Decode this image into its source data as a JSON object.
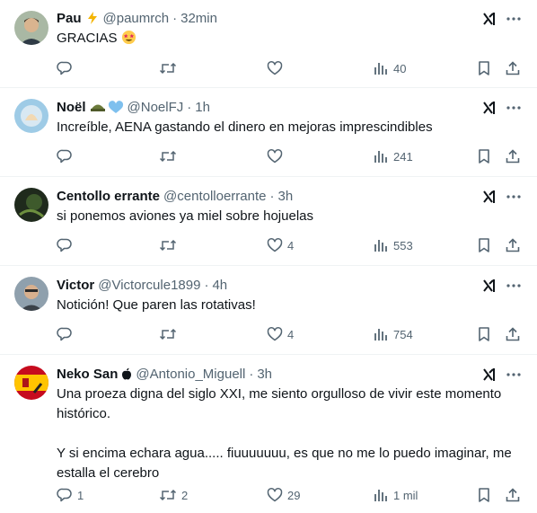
{
  "colors": {
    "muted": "#536471",
    "text": "#0f1419",
    "divider": "#eff3f4"
  },
  "tweets": [
    {
      "name": "Pau",
      "name_emoji": "lightning-emoji",
      "handle": "@paumrch",
      "time": "32min",
      "text": "GRACIAS",
      "text_emoji": "star-struck-emoji",
      "replies": "",
      "retweets": "",
      "likes": "",
      "views": "40"
    },
    {
      "name": "Noël",
      "name_emoji": "helmet-and-heart-emoji",
      "handle": "@NoelFJ",
      "time": "1h",
      "text": "Increíble, AENA gastando el dinero en mejoras imprescindibles",
      "replies": "",
      "retweets": "",
      "likes": "",
      "views": "241"
    },
    {
      "name": "Centollo errante",
      "handle": "@centolloerrante",
      "time": "3h",
      "text": "si ponemos aviones ya miel sobre hojuelas",
      "replies": "",
      "retweets": "",
      "likes": "4",
      "views": "553"
    },
    {
      "name": "Victor",
      "handle": "@Victorcule1899",
      "time": "4h",
      "text": "Notición! Que paren las rotativas!",
      "replies": "",
      "retweets": "",
      "likes": "4",
      "views": "754"
    },
    {
      "name": "Neko San",
      "name_emoji": "apple-logo",
      "handle": "@Antonio_Miguell",
      "time": "3h",
      "text": "Una proeza digna del siglo XXI, me siento orgulloso de vivir este momento histórico.\n\nY si encima echara agua..... fiuuuuuuu, es que no me lo puedo imaginar, me estalla el cerebro",
      "replies": "1",
      "retweets": "2",
      "likes": "29",
      "views": "1 mil"
    }
  ]
}
